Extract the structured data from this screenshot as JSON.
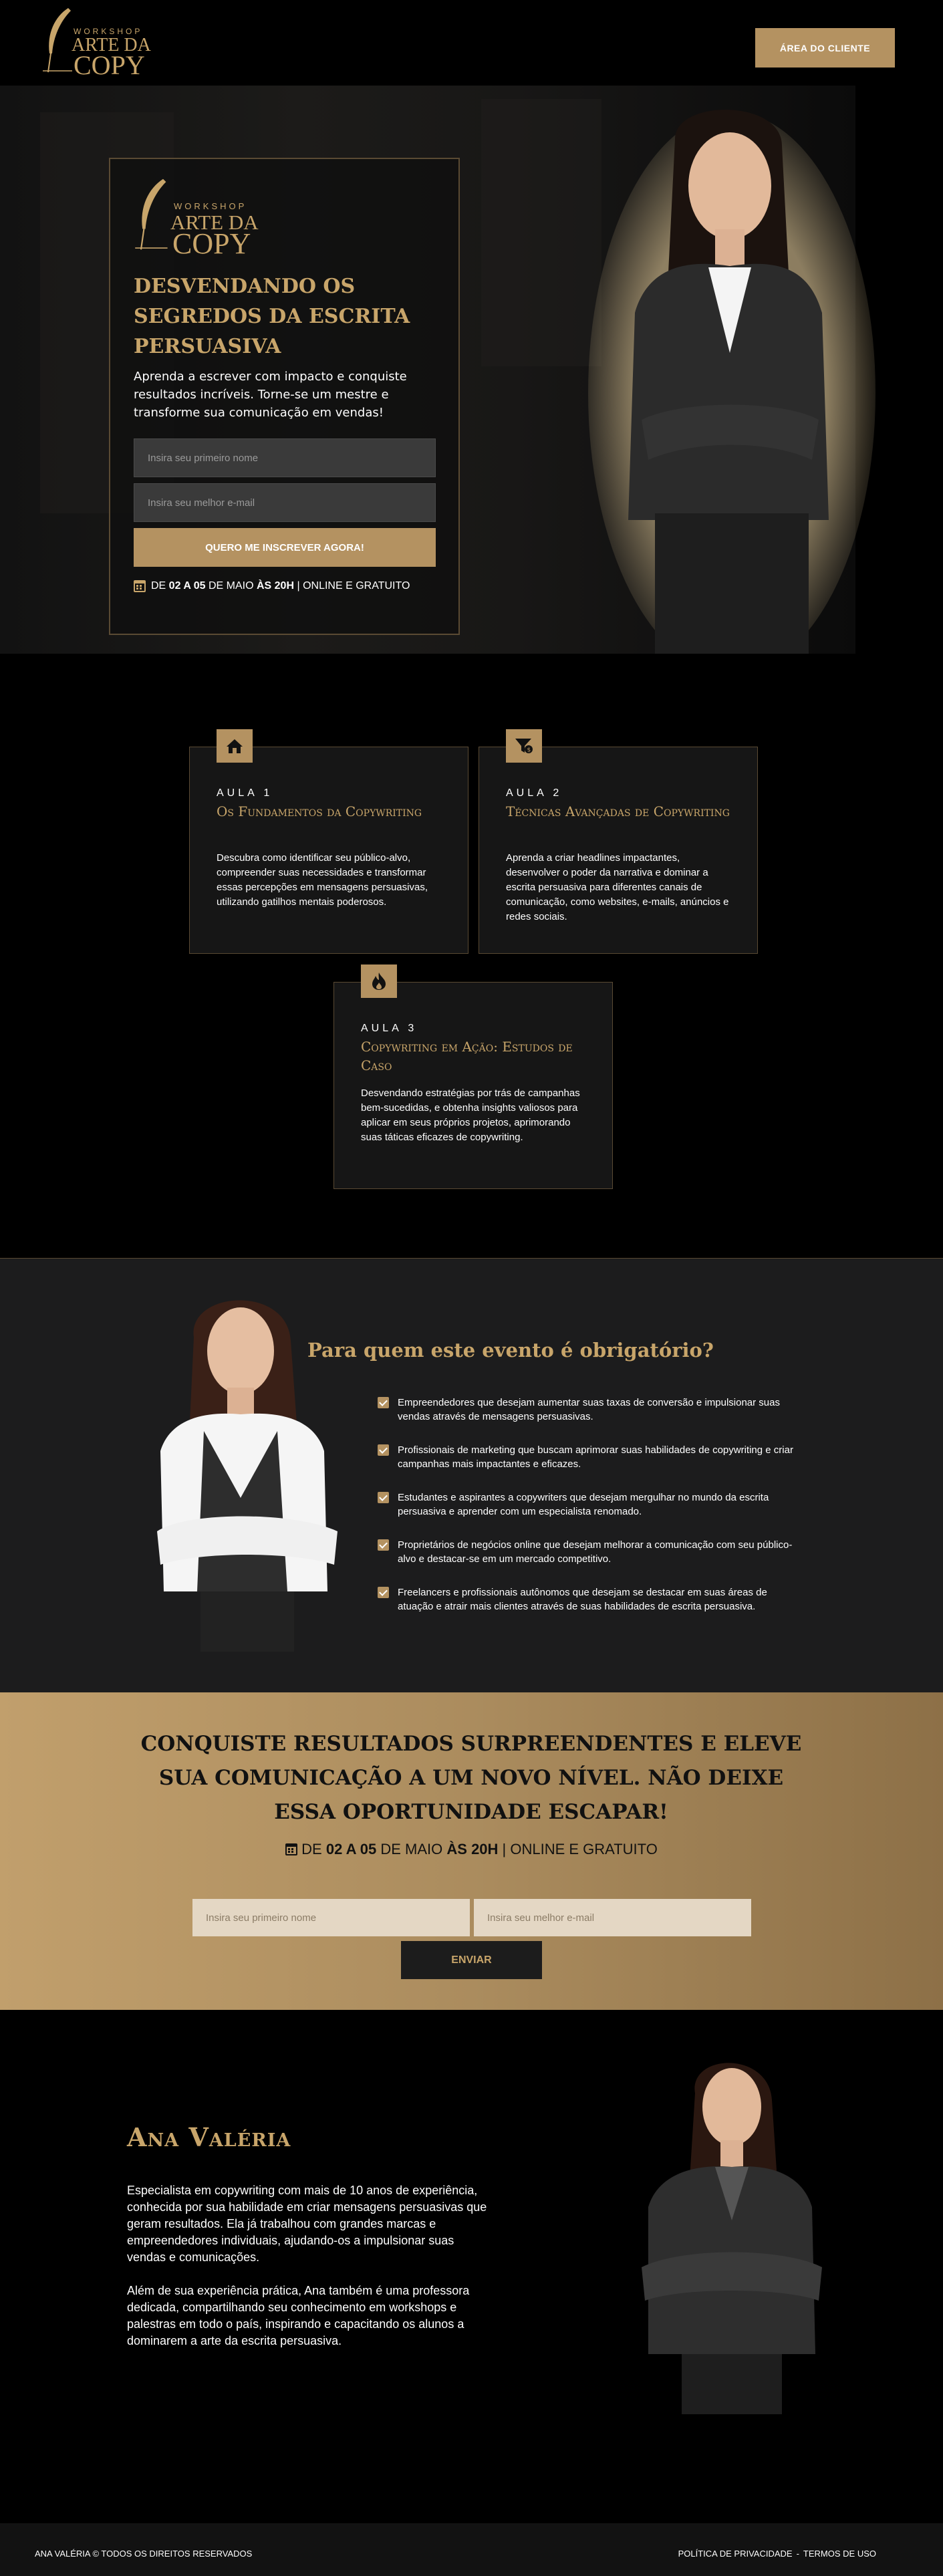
{
  "logo": {
    "workshop": "WORKSHOP",
    "line1": "ARTE DA",
    "line2": "COPY"
  },
  "header": {
    "client_area": "ÁREA DO CLIENTE"
  },
  "hero": {
    "title": "DESVENDANDO OS SEGREDOS DA ESCRITA PERSUASIVA",
    "subtitle": "Aprenda a escrever com impacto e conquiste resultados incríveis. Torne-se um mestre e transforme sua comunicação em vendas!",
    "first_name_placeholder": "Insira seu primeiro nome",
    "email_placeholder": "Insira seu melhor e-mail",
    "cta": "QUERO ME INSCREVER AGORA!",
    "date": {
      "pre": "DE ",
      "days": "02 A 05",
      "mid": " DE MAIO ",
      "time": "ÀS 20H",
      "post": " | ONLINE E GRATUITO"
    }
  },
  "lessons": [
    {
      "icon": "home-icon",
      "num": "AULA 1",
      "title": "Os Fundamentos da Copywriting",
      "desc": "Descubra como identificar seu público-alvo, compreender suas necessidades e transformar essas percepções em mensagens persuasivas, utilizando gatilhos mentais poderosos."
    },
    {
      "icon": "funnel-dollar-icon",
      "num": "AULA 2",
      "title": "Técnicas Avançadas de Copywriting",
      "desc": "Aprenda a criar headlines impactantes, desenvolver o poder da narrativa e dominar a escrita persuasiva para diferentes canais de comunicação, como websites, e-mails, anúncios e redes sociais."
    },
    {
      "icon": "fire-icon",
      "num": "AULA 3",
      "title": "Copywriting em Ação: Estudos de Caso",
      "desc": "Desvendando estratégias por trás de campanhas bem-sucedidas, e obtenha insights valiosos para aplicar em seus próprios projetos, aprimorando suas táticas eficazes de copywriting."
    }
  ],
  "audience": {
    "title": "Para quem este evento é obrigatório?",
    "items": [
      "Empreendedores que desejam aumentar suas taxas de conversão e impulsionar suas vendas através de mensagens persuasivas.",
      "Profissionais de marketing que buscam aprimorar suas habilidades de copywriting e criar campanhas mais impactantes e eficazes.",
      "Estudantes e aspirantes a copywriters que desejam mergulhar no mundo da escrita persuasiva e aprender com um especialista renomado.",
      "Proprietários de negócios online que desejam melhorar a comunicação com seu público-alvo e destacar-se em um mercado competitivo.",
      "Freelancers e profissionais autônomos que desejam se destacar em suas áreas de atuação e atrair mais clientes através de suas habilidades de escrita persuasiva."
    ]
  },
  "cta_section": {
    "title": "CONQUISTE RESULTADOS SURPREENDENTES E ELEVE SUA COMUNICAÇÃO A UM NOVO NÍVEL. NÃO DEIXE ESSA OPORTUNIDADE ESCAPAR!",
    "date": {
      "pre": "DE ",
      "days": "02 A 05",
      "mid": " DE MAIO ",
      "time": "ÀS 20H",
      "post": " | ONLINE E GRATUITO"
    },
    "first_name_placeholder": "Insira seu primeiro nome",
    "email_placeholder": "Insira seu melhor e-mail",
    "button": "ENVIAR"
  },
  "about": {
    "name": "Ana Valéria",
    "p1": "Especialista em copywriting com mais de 10 anos de experiência, conhecida por sua habilidade em criar mensagens persuasivas que geram resultados. Ela já trabalhou com grandes marcas e empreendedores individuais, ajudando-os a impulsionar suas vendas e comunicações.",
    "p2": "Além de sua experiência prática, Ana também é uma professora dedicada, compartilhando seu conhecimento em workshops e palestras em todo o país, inspirando e capacitando os alunos a dominarem a arte da escrita persuasiva."
  },
  "footer": {
    "copyright": "ANA VALÉRIA © TODOS OS DIREITOS RESERVADOS",
    "privacy": "POLÍTICA DE PRIVACIDADE",
    "sep": "-",
    "terms": "TERMOS DE USO"
  },
  "colors": {
    "gold": "#c8a56a",
    "button_gold": "#b49261",
    "dark": "#161616"
  }
}
